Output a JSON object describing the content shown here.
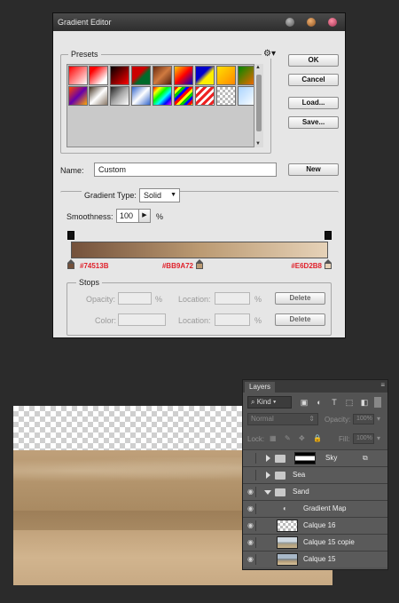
{
  "dialog": {
    "title": "Gradient Editor",
    "presets_label": "Presets",
    "buttons": {
      "ok": "OK",
      "cancel": "Cancel",
      "load": "Load...",
      "save": "Save...",
      "new": "New"
    },
    "name_label": "Name:",
    "name_value": "Custom",
    "gradient_type_label": "Gradient Type:",
    "gradient_type_value": "Solid",
    "smoothness_label": "Smoothness:",
    "smoothness_value": "100",
    "smoothness_unit": "%",
    "color_stops": [
      {
        "hex": "#74513B",
        "location": 0
      },
      {
        "hex": "#BB9A72",
        "location": 0.5
      },
      {
        "hex": "#E6D2B8",
        "location": 1
      }
    ],
    "opacity_stops": [
      {
        "location": 0
      },
      {
        "location": 1
      }
    ],
    "stops": {
      "legend": "Stops",
      "opacity_label": "Opacity:",
      "color_label": "Color:",
      "location_label": "Location:",
      "unit": "%",
      "delete_label": "Delete"
    }
  },
  "layers_panel": {
    "tab_label": "Layers",
    "filter_label": "Kind",
    "blend_mode": "Normal",
    "opacity_label": "Opacity:",
    "opacity_value": "100%",
    "lock_label": "Lock:",
    "fill_label": "Fill:",
    "fill_value": "100%",
    "layers": [
      {
        "name": "Sky",
        "type": "group-collapsed",
        "visible": false
      },
      {
        "name": "Sea",
        "type": "group-collapsed",
        "visible": false
      },
      {
        "name": "Sand",
        "type": "group-expanded",
        "visible": true
      },
      {
        "name": "Gradient Map",
        "type": "adjustment",
        "visible": true
      },
      {
        "name": "Calque 16",
        "type": "layer",
        "visible": true
      },
      {
        "name": "Calque 15 copie",
        "type": "layer",
        "visible": true
      },
      {
        "name": "Calque 15",
        "type": "layer",
        "visible": true
      }
    ]
  }
}
